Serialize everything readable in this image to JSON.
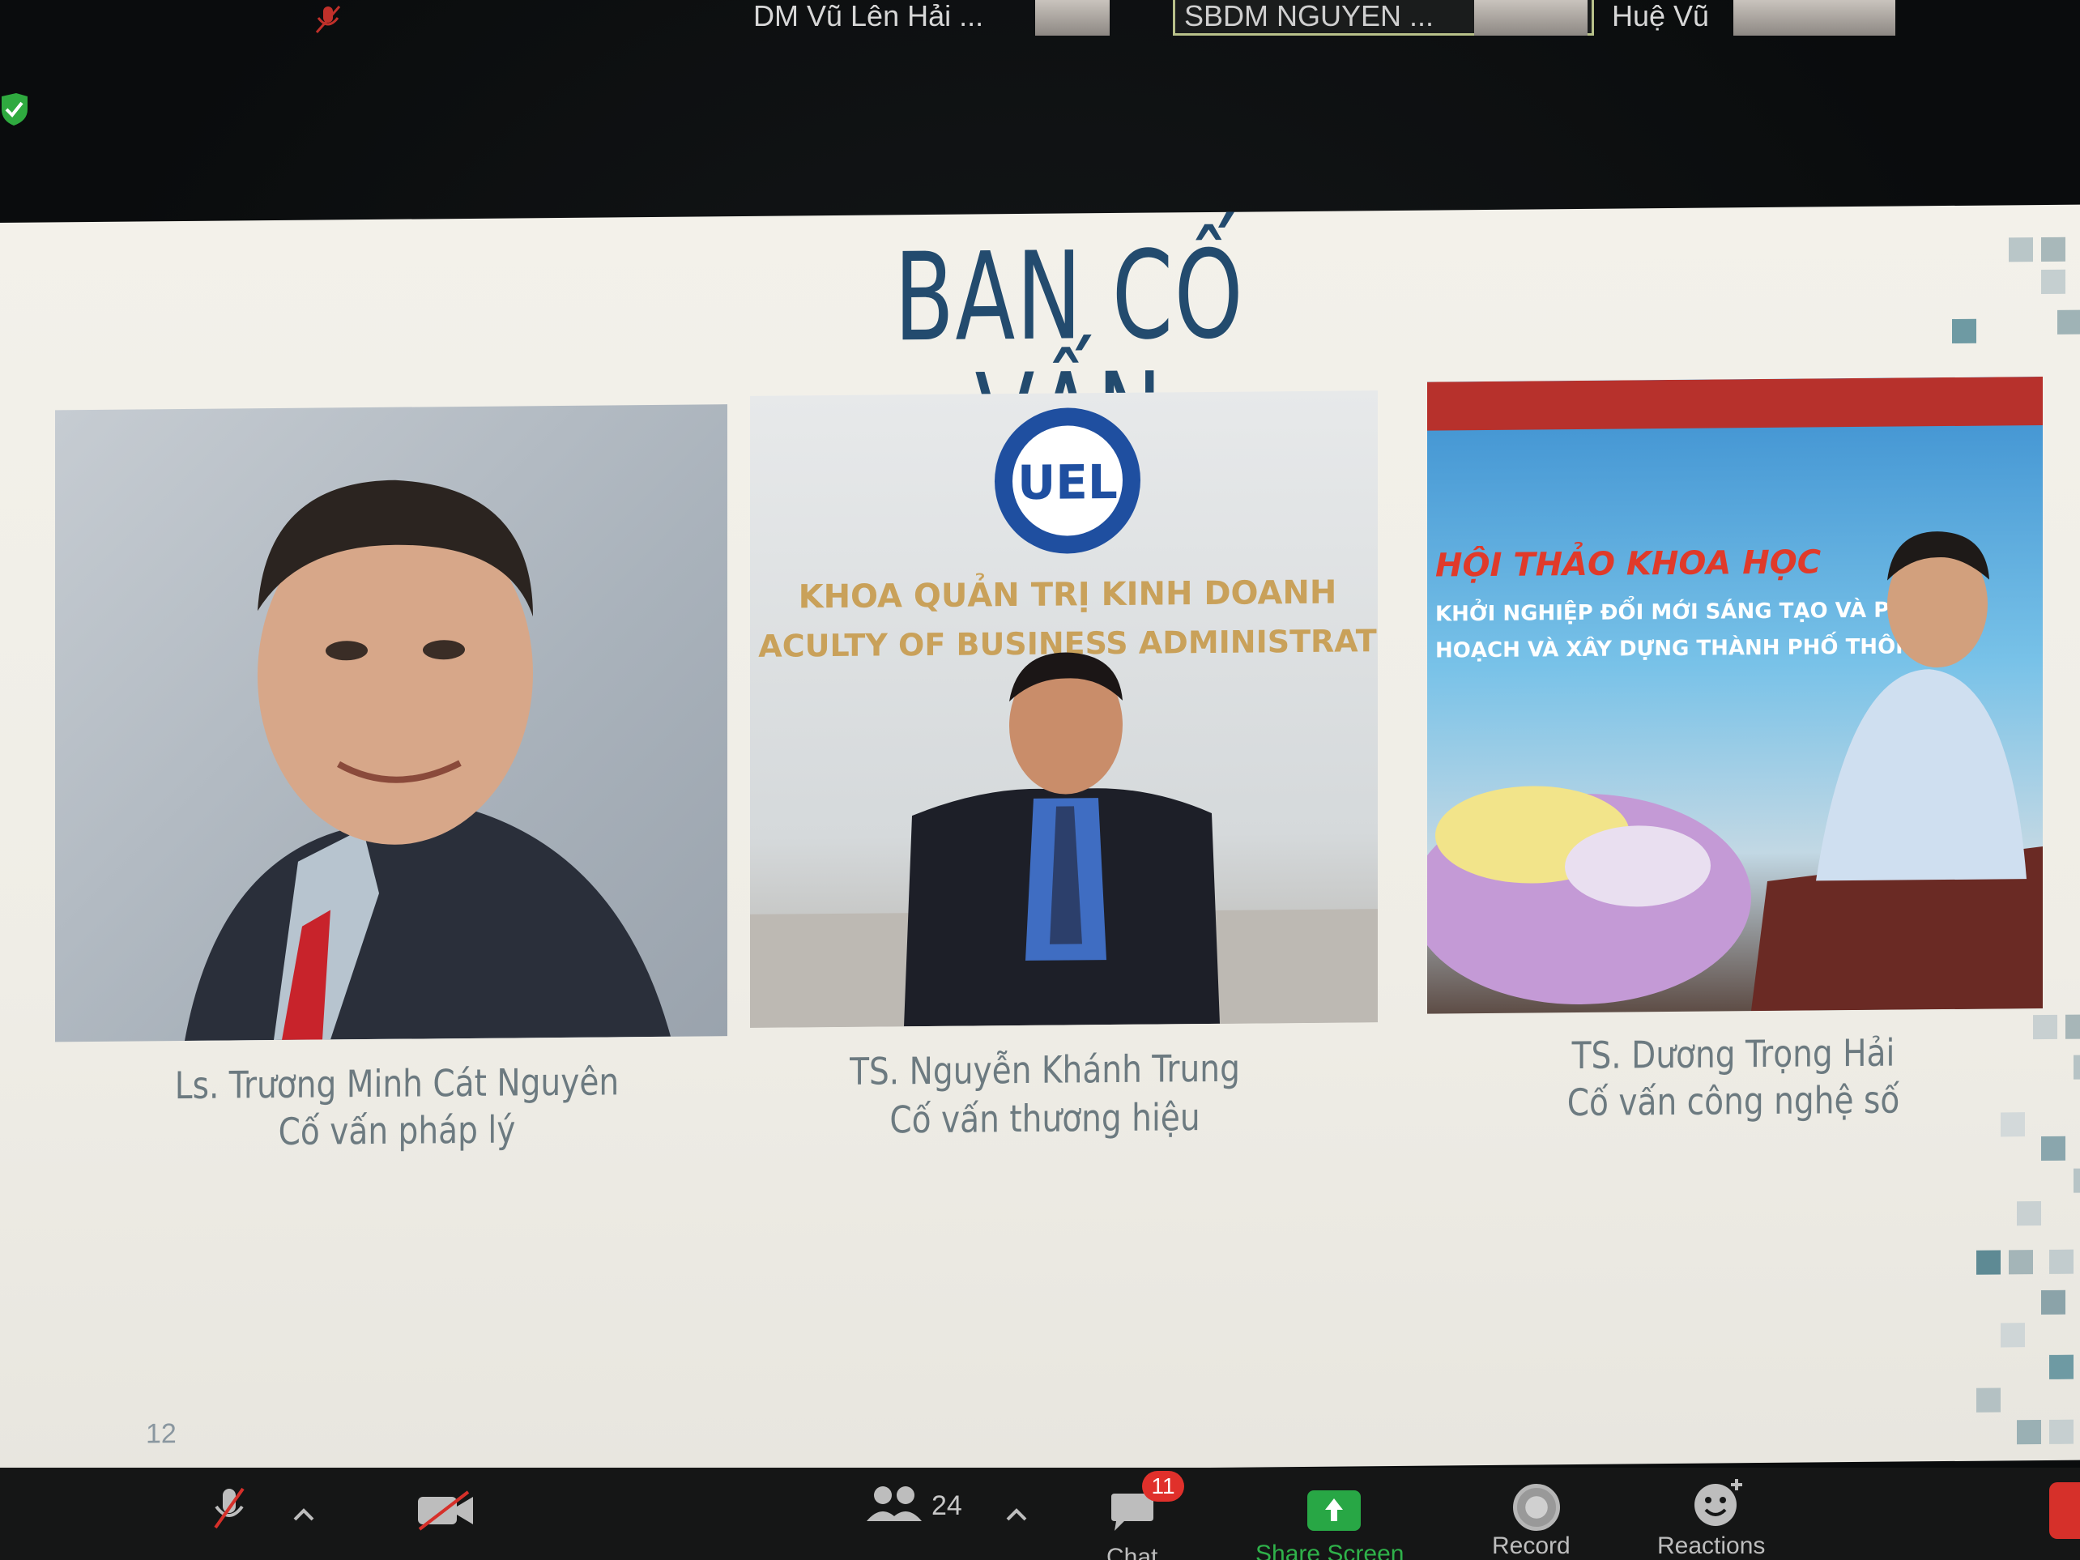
{
  "participants": [
    {
      "name": "DM Vũ Lên Hải ..."
    },
    {
      "name": "SBDM NGUYEN ..."
    },
    {
      "name": "Huệ Vũ"
    }
  ],
  "slide": {
    "title": "BAN CỐ VẤN",
    "page_number": "12",
    "photo_texts": {
      "logo": "UEL",
      "faculty_vi": "KHOA QUẢN TRỊ KINH DOANH",
      "faculty_en": "ACULTY OF BUSINESS ADMINISTRAT",
      "banner_title": "HỘI THẢO KHOA HỌC",
      "banner_line1": "KHỞI NGHIỆP ĐỔI MỚI SÁNG TẠO VÀ PHÁ",
      "banner_line2": "HOẠCH VÀ XÂY DỰNG THÀNH PHỐ THÔNG"
    },
    "advisors": [
      {
        "name": "Ls. Trương Minh Cát Nguyên",
        "role": "Cố vấn pháp lý"
      },
      {
        "name": "TS. Nguyễn Khánh Trung",
        "role": "Cố vấn thương hiệu"
      },
      {
        "name": "TS. Dương Trọng Hải",
        "role": "Cố vấn công nghệ số"
      }
    ],
    "colors": {
      "title": "#234b6e",
      "caption": "#6c7a80",
      "mosaic": "#5e8a94"
    }
  },
  "toolbar": {
    "participants_count": "24",
    "chat_badge": "11",
    "chat_label": "Chat",
    "share_label": "Share Screen",
    "record_label": "Record",
    "reactions_label": "Reactions",
    "icons": [
      "mic-muted-icon",
      "video-off-icon",
      "participants-icon",
      "chat-icon",
      "share-screen-icon",
      "record-icon",
      "reactions-icon"
    ]
  }
}
